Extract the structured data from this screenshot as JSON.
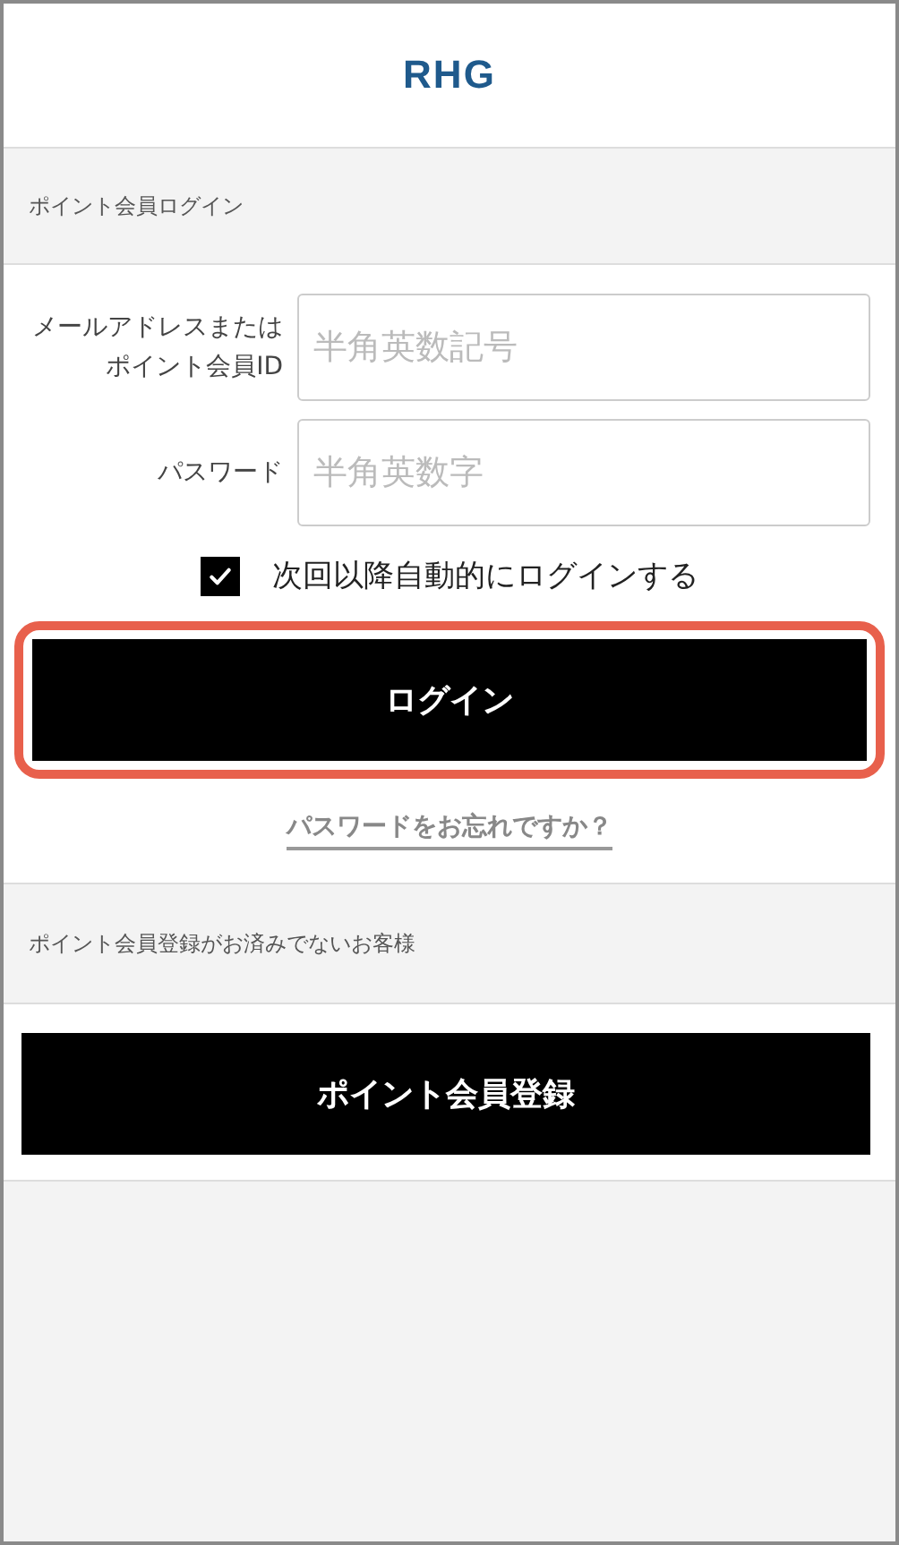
{
  "logo": "RHG",
  "login_section": {
    "title": "ポイント会員ログイン",
    "fields": [
      {
        "label_lines": [
          "メールアドレスまたは",
          "ポイント会員ID"
        ],
        "placeholder": "半角英数記号"
      },
      {
        "label_lines": [
          "パスワード"
        ],
        "placeholder": "半角英数字"
      }
    ],
    "auto_login": {
      "label": "次回以降自動的にログインする",
      "checked": true
    },
    "login_button": {
      "label": "ログイン",
      "highlighted": true
    },
    "forgot_link": "パスワードをお忘れですか？"
  },
  "register_section": {
    "title": "ポイント会員登録がお済みでないお客様",
    "button": "ポイント会員登録"
  }
}
